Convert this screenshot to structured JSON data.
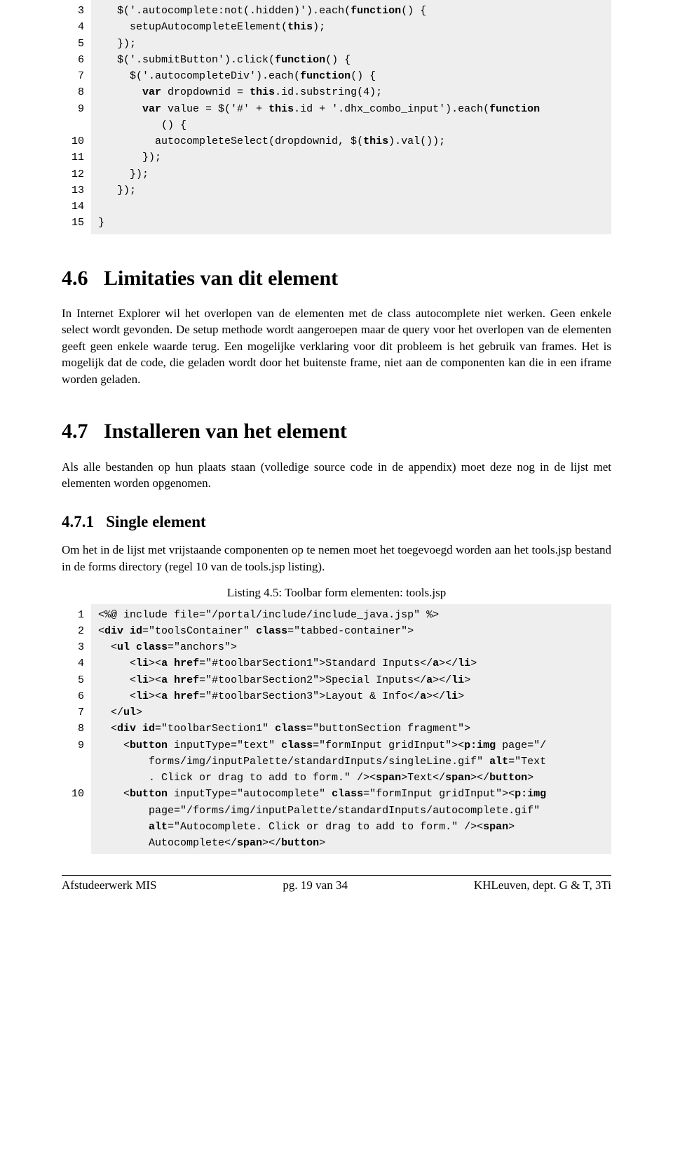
{
  "listing1": {
    "start": 3,
    "lines": [
      {
        "t": "   $('.autocomplete:not(.hidden)').each("
      },
      {
        "kw": "function"
      },
      {
        "t": "() {",
        "nl": 1
      },
      {
        "t": "     setupAutocompleteElement("
      },
      {
        "kw": "this"
      },
      {
        "t": ");",
        "nl": 1
      },
      {
        "t": "   });",
        "nl": 1
      },
      {
        "t": "   $('.submitButton').click("
      },
      {
        "kw": "function"
      },
      {
        "t": "() {",
        "nl": 1
      },
      {
        "t": "     $('.autocompleteDiv').each("
      },
      {
        "kw": "function"
      },
      {
        "t": "() {",
        "nl": 1
      },
      {
        "t": "       "
      },
      {
        "kw": "var"
      },
      {
        "t": " dropdownid = "
      },
      {
        "kw": "this"
      },
      {
        "t": ".id.substring(4);",
        "nl": 1
      },
      {
        "t": "       "
      },
      {
        "kw": "var"
      },
      {
        "t": " value = $('#' + "
      },
      {
        "kw": "this"
      },
      {
        "t": ".id + '.dhx_combo_input').each("
      },
      {
        "kw": "function"
      },
      {
        "t": "\n          () {",
        "nl": 1
      },
      {
        "t": "         autocompleteSelect(dropdownid, $("
      },
      {
        "kw": "this"
      },
      {
        "t": ").val());",
        "nl": 1
      },
      {
        "t": "       });",
        "nl": 1
      },
      {
        "t": "     });",
        "nl": 1
      },
      {
        "t": "   });",
        "nl": 1
      },
      {
        "t": "",
        "nl": 1
      },
      {
        "t": "}",
        "nl": 1
      }
    ],
    "gutter": "3\n4\n5\n6\n7\n8\n9\n\n10\n11\n12\n13\n14\n15"
  },
  "sec46": {
    "num": "4.6",
    "title": "Limitaties van dit element",
    "body": "In Internet Explorer wil het overlopen van de elementen met de class autocomplete niet werken. Geen enkele select wordt gevonden. De setup methode wordt aangeroepen maar de query voor het overlopen van de elementen geeft geen enkele waarde terug. Een mogelijke verklaring voor dit probleem is het gebruik van frames. Het is mogelijk dat de code, die geladen wordt door het buitenste frame, niet aan de componenten kan die in een iframe worden geladen."
  },
  "sec47": {
    "num": "4.7",
    "title": "Installeren van het element",
    "body": "Als alle bestanden op hun plaats staan (volledige source code in de appendix) moet deze nog in de lijst met elementen worden opgenomen."
  },
  "sub471": {
    "num": "4.7.1",
    "title": "Single element",
    "body": "Om het in de lijst met vrijstaande componenten op te nemen moet het toegevoegd worden aan het tools.jsp bestand in de forms directory (regel 10 van de tools.jsp listing)."
  },
  "listing2": {
    "caption": "Listing 4.5: Toolbar form elementen: tools.jsp",
    "start": 1,
    "gutter": "1\n2\n3\n4\n5\n6\n7\n8\n9\n\n\n10\n\n\n",
    "html": "&lt;%@ include file=\"/portal/include/include_java.jsp\" %&gt;\n&lt;<b>div id</b>=\"toolsContainer\" <b>class</b>=\"tabbed-container\"&gt;\n  &lt;<b>ul class</b>=\"anchors\"&gt;\n     &lt;<b>li</b>&gt;&lt;<b>a href</b>=\"#toolbarSection1\"&gt;Standard Inputs&lt;/<b>a</b>&gt;&lt;/<b>li</b>&gt;\n     &lt;<b>li</b>&gt;&lt;<b>a href</b>=\"#toolbarSection2\"&gt;Special Inputs&lt;/<b>a</b>&gt;&lt;/<b>li</b>&gt;\n     &lt;<b>li</b>&gt;&lt;<b>a href</b>=\"#toolbarSection3\"&gt;Layout &amp; Info&lt;/<b>a</b>&gt;&lt;/<b>li</b>&gt;\n  &lt;/<b>ul</b>&gt;\n  &lt;<b>div id</b>=\"toolbarSection1\" <b>class</b>=\"buttonSection fragment\"&gt;\n    &lt;<b>button</b> inputType=\"text\" <b>class</b>=\"formInput gridInput\"&gt;&lt;<b>p:img</b> page=\"/\n        forms/img/inputPalette/standardInputs/singleLine.gif\" <b>alt</b>=\"Text\n        . Click or drag to add to form.\" /&gt;&lt;<b>span</b>&gt;Text&lt;/<b>span</b>&gt;&lt;/<b>button</b>&gt;\n    &lt;<b>button</b> inputType=\"autocomplete\" <b>class</b>=\"formInput gridInput\"&gt;&lt;<b>p:img</b>\n        page=\"/forms/img/inputPalette/standardInputs/autocomplete.gif\"\n        <b>alt</b>=\"Autocomplete. Click or drag to add to form.\" /&gt;&lt;<b>span</b>&gt;\n        Autocomplete&lt;/<b>span</b>&gt;&lt;/<b>button</b>&gt;"
  },
  "footer": {
    "left": "Afstudeerwerk MIS",
    "center": "pg. 19 van 34",
    "right": "KHLeuven, dept. G & T, 3Ti"
  }
}
